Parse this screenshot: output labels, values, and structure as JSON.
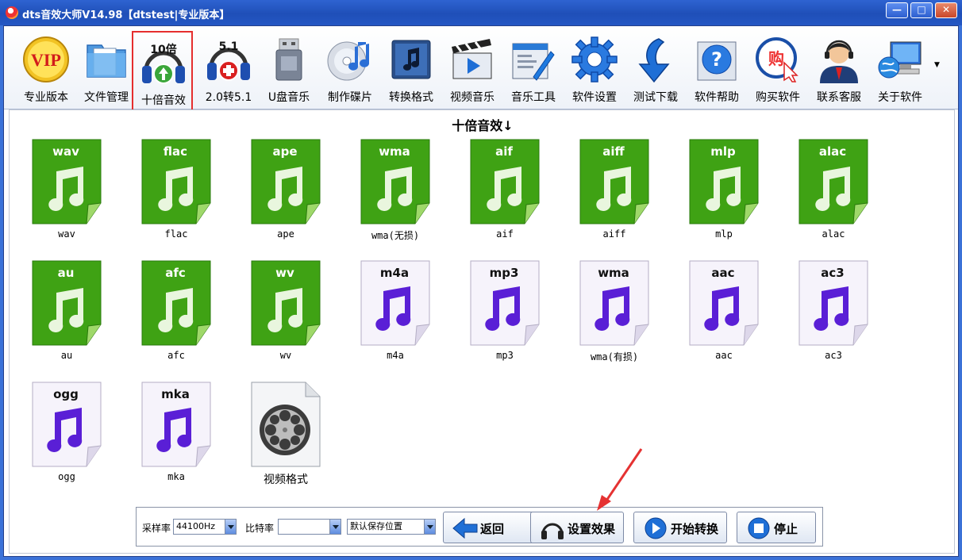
{
  "window": {
    "title": "dts音效大师V14.98【dtstest|专业版本】",
    "controls": [
      "—",
      "□",
      "✕"
    ]
  },
  "toolbar": {
    "items": [
      {
        "label": "专业版本",
        "icon": "vip-icon",
        "badge": "VIP"
      },
      {
        "label": "文件管理",
        "icon": "folder-icon"
      },
      {
        "label": "十倍音效",
        "icon": "headphones-10x-icon",
        "badge": "10倍",
        "selected": true
      },
      {
        "label": "2.0转5.1",
        "icon": "headphones-51-icon",
        "badge": "5.1"
      },
      {
        "label": "U盘音乐",
        "icon": "usb-drive-icon"
      },
      {
        "label": "制作碟片",
        "icon": "disc-icon"
      },
      {
        "label": "转换格式",
        "icon": "music-note-icon"
      },
      {
        "label": "视频音乐",
        "icon": "video-clapper-icon"
      },
      {
        "label": "音乐工具",
        "icon": "tools-icon"
      },
      {
        "label": "软件设置",
        "icon": "gear-icon"
      },
      {
        "label": "测试下载",
        "icon": "download-arrow-icon"
      },
      {
        "label": "软件帮助",
        "icon": "help-icon"
      },
      {
        "label": "购买软件",
        "icon": "buy-icon",
        "badge": "购"
      },
      {
        "label": "联系客服",
        "icon": "support-agent-icon"
      },
      {
        "label": "关于软件",
        "icon": "computer-globe-icon"
      }
    ]
  },
  "content": {
    "heading": "十倍音效↓",
    "formats": [
      {
        "badge": "wav",
        "caption": "wav",
        "style": "lossless"
      },
      {
        "badge": "flac",
        "caption": "flac",
        "style": "lossless"
      },
      {
        "badge": "ape",
        "caption": "ape",
        "style": "lossless"
      },
      {
        "badge": "wma",
        "caption": "wma(无损)",
        "style": "lossless"
      },
      {
        "badge": "aif",
        "caption": "aif",
        "style": "lossless"
      },
      {
        "badge": "aiff",
        "caption": "aiff",
        "style": "lossless"
      },
      {
        "badge": "mlp",
        "caption": "mlp",
        "style": "lossless"
      },
      {
        "badge": "alac",
        "caption": "alac",
        "style": "lossless"
      },
      {
        "badge": "au",
        "caption": "au",
        "style": "lossless"
      },
      {
        "badge": "afc",
        "caption": "afc",
        "style": "lossless"
      },
      {
        "badge": "wv",
        "caption": "wv",
        "style": "lossless"
      },
      {
        "badge": "m4a",
        "caption": "m4a",
        "style": "lossy"
      },
      {
        "badge": "mp3",
        "caption": "mp3",
        "style": "lossy"
      },
      {
        "badge": "wma",
        "caption": "wma(有损)",
        "style": "lossy"
      },
      {
        "badge": "aac",
        "caption": "aac",
        "style": "lossy"
      },
      {
        "badge": "ac3",
        "caption": "ac3",
        "style": "lossy"
      },
      {
        "badge": "ogg",
        "caption": "ogg",
        "style": "lossy"
      },
      {
        "badge": "mka",
        "caption": "mka",
        "style": "lossy"
      },
      {
        "badge": "",
        "caption": "视频格式",
        "style": "video"
      }
    ]
  },
  "bottom": {
    "sample_rate_label": "采样率",
    "sample_rate_value": "44100Hz",
    "bitrate_label": "比特率",
    "bitrate_value": "",
    "save_location_value": "默认保存位置",
    "buttons": {
      "back": "返回",
      "settings": "设置效果",
      "start": "开始转换",
      "stop": "停止"
    }
  },
  "colors": {
    "titlebar": "#2457c4",
    "lossless_green": "#3fa214",
    "lossy_purple": "#5a1fd6",
    "selection_red": "#e52e2e",
    "annotation_red": "#e53232"
  }
}
